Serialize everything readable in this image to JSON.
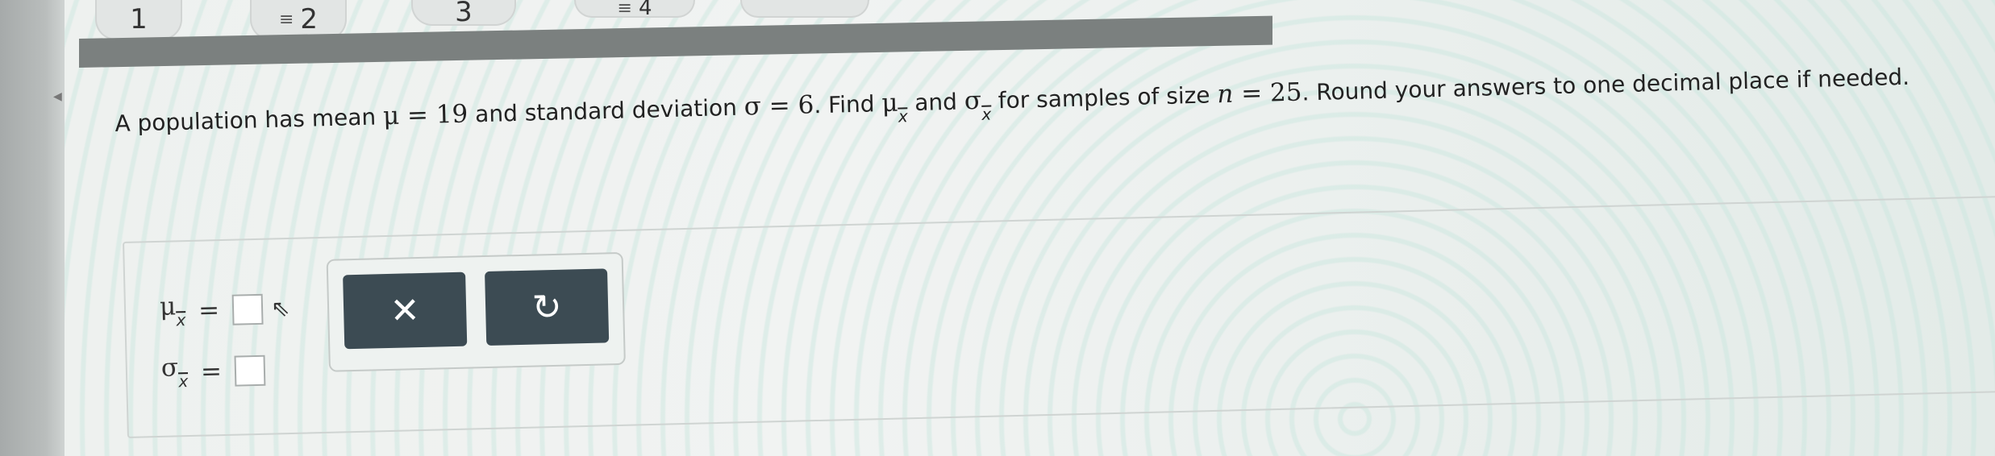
{
  "tabs": [
    {
      "label": "1",
      "has_icon": false
    },
    {
      "label": "2",
      "has_icon": true
    },
    {
      "label": "3",
      "has_icon": false
    },
    {
      "label": "4",
      "has_icon": true
    }
  ],
  "question": {
    "p1": "A population has mean ",
    "mu": "μ",
    "eq1": " = 19",
    "p2": " and standard deviation ",
    "sigma": "σ",
    "eq2": " = 6",
    "p3": ". Find ",
    "mu_x": "μ",
    "x1": "x",
    "p4": " and ",
    "sigma_x": "σ",
    "x2": "x",
    "p5": " for samples of size ",
    "n": "n",
    "eq3": " = 25",
    "p6": ". Round your answers to one decimal place if needed."
  },
  "answers": [
    {
      "symbol": "μ",
      "sub": "x",
      "equals": "="
    },
    {
      "symbol": "σ",
      "sub": "x",
      "equals": "="
    }
  ],
  "buttons": {
    "clear_label": "✕",
    "reset_label": "↻"
  }
}
